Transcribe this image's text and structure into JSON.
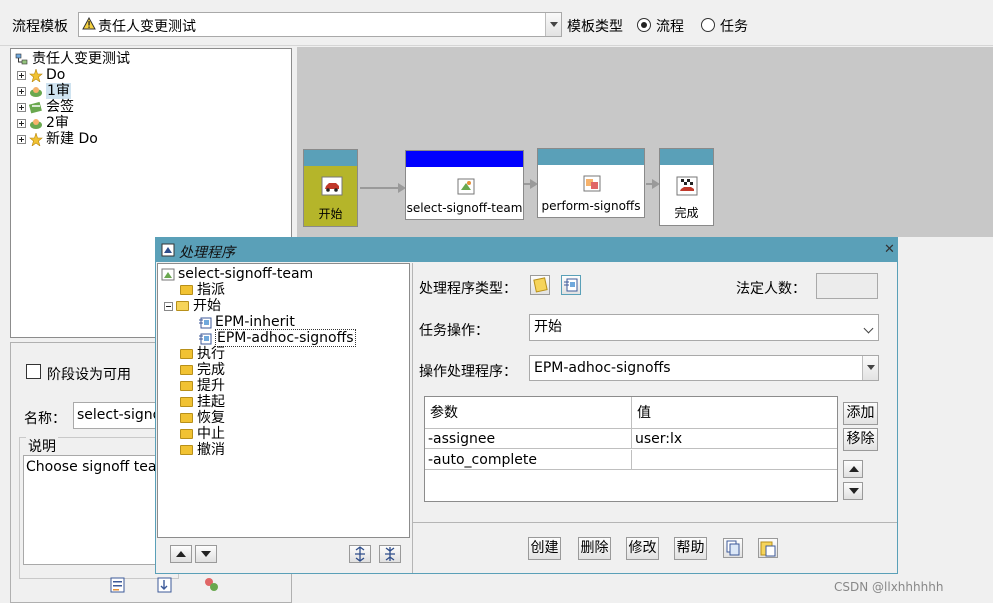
{
  "top": {
    "template_label": "流程模板",
    "template_value": "责任人变更测试",
    "template_type_label": "模板类型",
    "radio_process": "流程",
    "radio_task": "任务"
  },
  "tree": {
    "root": "责任人变更测试",
    "items": [
      {
        "label": "Do"
      },
      {
        "label": "1审"
      },
      {
        "label": "会签"
      },
      {
        "label": "2审"
      },
      {
        "label": "新建 Do"
      }
    ]
  },
  "lower": {
    "stage_checkbox": "阶段设为可用",
    "name_label": "名称：",
    "name_value": "select-signoff-team",
    "desc_label": "说明",
    "desc_value": "Choose signoff team"
  },
  "canvas": {
    "nodes": [
      "开始",
      "select-signoff-team",
      "perform-signoffs",
      "完成"
    ]
  },
  "dialog": {
    "title": "处理程序",
    "tree_root": "select-signoff-team",
    "tree_items": [
      "指派",
      "开始",
      "EPM-inherit",
      "EPM-adhoc-signoffs",
      "执行",
      "完成",
      "提升",
      "挂起",
      "恢复",
      "中止",
      "撤消"
    ],
    "handler_type_label": "处理程序类型：",
    "quorum_label": "法定人数：",
    "quorum_value": "",
    "task_action_label": "任务操作：",
    "task_action_value": "开始",
    "handler_label": "操作处理程序：",
    "handler_value": "EPM-adhoc-signoffs",
    "table_headers": [
      "参数",
      "值"
    ],
    "table_rows": [
      {
        "param": "-assignee",
        "value": "user:lx"
      },
      {
        "param": "-auto_complete",
        "value": ""
      }
    ],
    "add_button": "添加",
    "remove_button": "移除",
    "create_button": "创建",
    "delete_button": "删除",
    "modify_button": "修改",
    "help_button": "帮助"
  },
  "watermark": "CSDN @llxhhhhhh",
  "colors": {
    "title_bar": "#5aa0b8",
    "selected_node_header": "#0000ff",
    "canvas_bg": "#c8c8c8"
  }
}
